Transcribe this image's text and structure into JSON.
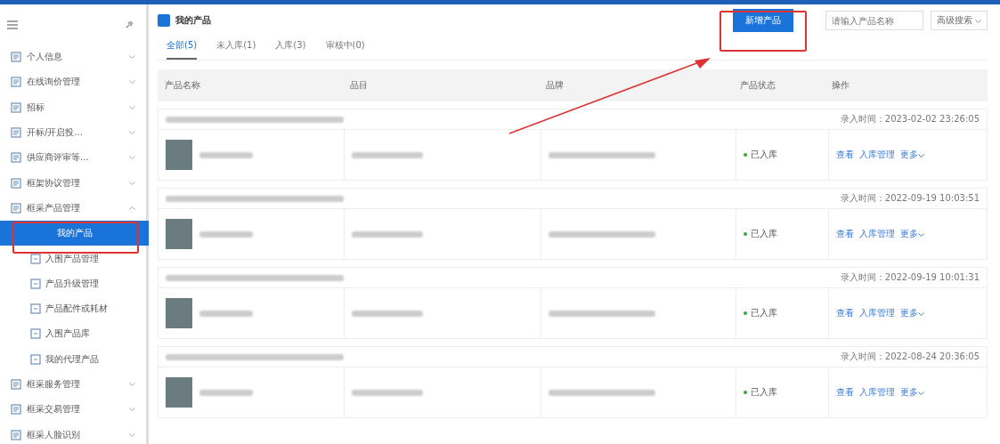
{
  "sidebar": {
    "items": [
      {
        "label": "个人信息",
        "expanded": false
      },
      {
        "label": "在线询价管理",
        "expanded": false
      },
      {
        "label": "招标",
        "expanded": false
      },
      {
        "label": "开标/开启投...",
        "expanded": false
      },
      {
        "label": "供应商评审等...",
        "expanded": false
      },
      {
        "label": "框架协议管理",
        "expanded": false
      },
      {
        "label": "框采产品管理",
        "expanded": true,
        "children": [
          {
            "label": "我的产品",
            "selected": true
          },
          {
            "label": "入围产品管理",
            "selected": false
          },
          {
            "label": "产品升级管理",
            "selected": false
          },
          {
            "label": "产品配件或耗材",
            "selected": false
          },
          {
            "label": "入围产品库",
            "selected": false
          },
          {
            "label": "我的代理产品",
            "selected": false
          }
        ]
      },
      {
        "label": "框采服务管理",
        "expanded": false
      },
      {
        "label": "框采交易管理",
        "expanded": false
      },
      {
        "label": "框采人脸识别",
        "expanded": false
      }
    ]
  },
  "page": {
    "title": "我的产品",
    "add_button": "新增产品",
    "search": {
      "placeholder": "请输入产品名称"
    },
    "advanced_search": "高级搜索"
  },
  "tabs": [
    {
      "label": "全部(5)",
      "selected": true
    },
    {
      "label": "未入库(1)",
      "selected": false
    },
    {
      "label": "入库(3)",
      "selected": false
    },
    {
      "label": "审核中(0)",
      "selected": false
    }
  ],
  "table": {
    "columns": [
      "产品名称",
      "品目",
      "品牌",
      "产品状态",
      "操作"
    ],
    "rows": [
      {
        "time": "录入时间：2023-02-02 23:26:05",
        "status": "已入库",
        "actions": [
          "查看",
          "入库管理",
          "更多"
        ]
      },
      {
        "time": "录入时间：2022-09-19 10:03:51",
        "status": "已入库",
        "actions": [
          "查看",
          "入库管理",
          "更多"
        ]
      },
      {
        "time": "录入时间：2022-09-19 10:01:31",
        "status": "已入库",
        "actions": [
          "查看",
          "入库管理",
          "更多"
        ]
      },
      {
        "time": "录入时间：2022-08-24 20:36:05",
        "status": "已入库",
        "actions": [
          "查看",
          "入库管理",
          "更多"
        ]
      }
    ]
  }
}
